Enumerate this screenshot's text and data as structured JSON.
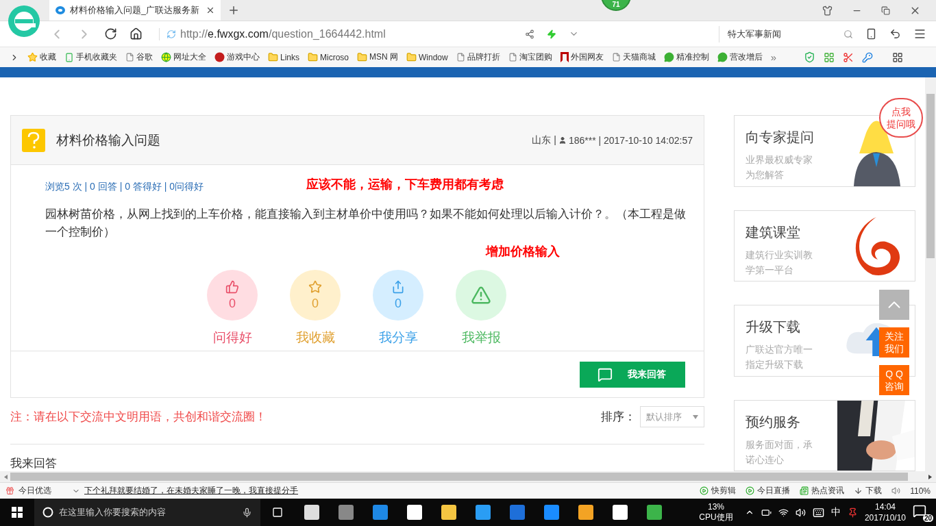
{
  "browser": {
    "tab_title": "材料价格输入问题_广联达服务新",
    "badge": "71",
    "url_prefix": "http://",
    "url_host": "e.fwxgx.com",
    "url_path": "/question_1664442.html",
    "search_value": "特大军事新闻"
  },
  "bookmarks": [
    {
      "label": "收藏",
      "kind": "star"
    },
    {
      "label": "手机收藏夹",
      "kind": "phone"
    },
    {
      "label": "谷歌",
      "kind": "page"
    },
    {
      "label": "网址大全",
      "kind": "globe"
    },
    {
      "label": "游戏中心",
      "kind": "game"
    },
    {
      "label": "Links",
      "kind": "folder"
    },
    {
      "label": "Microso",
      "kind": "folder"
    },
    {
      "label": "MSN 网",
      "kind": "folder"
    },
    {
      "label": "Window",
      "kind": "folder"
    },
    {
      "label": "品牌打折",
      "kind": "page"
    },
    {
      "label": "淘宝团购",
      "kind": "page"
    },
    {
      "label": "外国网友",
      "kind": "flag"
    },
    {
      "label": "天猫商城",
      "kind": "page"
    },
    {
      "label": "精准控制",
      "kind": "chat"
    },
    {
      "label": "营改增后",
      "kind": "chat"
    }
  ],
  "bookmarks_more": "»",
  "question": {
    "title": "材料价格输入问题",
    "location": "山东 |",
    "user": "186*** | 2017-10-10 14:02:57",
    "stats": "浏览5 次 | 0 回答 | 0 答得好 | 0问得好",
    "body": "园林树苗价格，从网上找到的上车价格，能直接输入到主材单价中使用吗？如果不能如何处理以后输入计价？。（本工程是做一个控制价）",
    "actions": [
      {
        "count": "0",
        "label": "问得好",
        "kind": "like"
      },
      {
        "count": "0",
        "label": "我收藏",
        "kind": "favorite"
      },
      {
        "count": "0",
        "label": "我分享",
        "kind": "share"
      },
      {
        "label": "我举报",
        "kind": "report"
      }
    ],
    "answer_button": "我来回答"
  },
  "annotations": [
    "应该不能，运输，下车费用都有考虑",
    "增加价格输入"
  ],
  "notice": "注：请在以下交流中文明用语，共创和谐交流圈！",
  "sort": {
    "label": "排序：",
    "value": "默认排序"
  },
  "answers_heading": "我来回答",
  "sidebar": [
    {
      "title": "向专家提问",
      "subtitle": "业界最权威专家为您解答",
      "kind": "mascot"
    },
    {
      "title": "建筑课堂",
      "subtitle": "建筑行业实训教学第一平台",
      "kind": "logo"
    },
    {
      "title": "升级下载",
      "subtitle": "广联达官方唯一指定升级下载",
      "kind": "cloud"
    },
    {
      "title": "预约服务",
      "subtitle": "服务面对面，承诺心连心",
      "kind": "picture"
    }
  ],
  "bubble": [
    "点我",
    "提问哦"
  ],
  "float_buttons": [
    "关注我们",
    "Q Q咨询"
  ],
  "status_bar": {
    "label": "今日优选",
    "headline": "下个礼拜就要结婚了，在未婚夫家睡了一晚，我直接提分手",
    "items": [
      {
        "label": "快剪辑",
        "kind": "clip"
      },
      {
        "label": "今日直播",
        "kind": "live"
      },
      {
        "label": "热点资讯",
        "kind": "news"
      },
      {
        "label": "下载",
        "kind": "download"
      }
    ],
    "zoom": "110%"
  },
  "taskbar": {
    "search_placeholder": "在这里输入你要搜索的内容",
    "cpu_value": "13%",
    "cpu_label": "CPU使用",
    "ime": "中",
    "time": "14:04",
    "date": "2017/10/10",
    "notifications": "20"
  }
}
